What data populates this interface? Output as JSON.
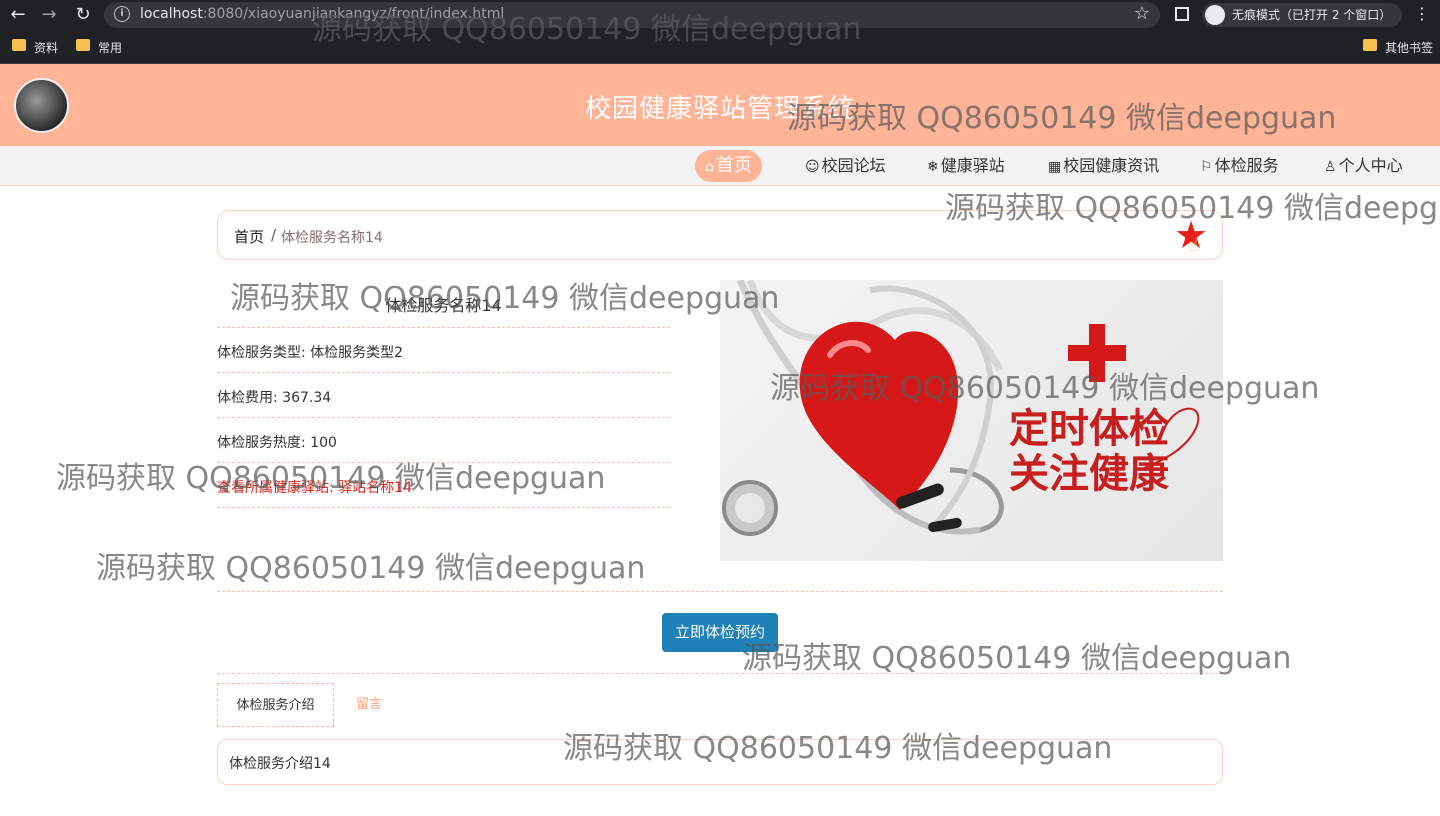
{
  "browser": {
    "url_host": "localhost",
    "url_rest": ":8080/xiaoyuanjiankangyz/front/index.html",
    "incognito_label": "无痕模式（已打开 2 个窗口）",
    "bookmarks": [
      "资料",
      "常用"
    ],
    "other_bookmarks": "其他书签"
  },
  "site": {
    "title": "校园健康驿站管理系统"
  },
  "nav": {
    "items": [
      {
        "icon": "⌂",
        "label": "首页"
      },
      {
        "icon": "☺",
        "label": "校园论坛"
      },
      {
        "icon": "❄",
        "label": "健康驿站"
      },
      {
        "icon": "▦",
        "label": "校园健康资讯"
      },
      {
        "icon": "⚐",
        "label": "体检服务"
      },
      {
        "icon": "♙",
        "label": "个人中心"
      }
    ]
  },
  "breadcrumb": {
    "home": "首页",
    "separator": "/",
    "current": "体检服务名称14"
  },
  "detail": {
    "title": "体检服务名称14",
    "type": "体检服务类型: 体检服务类型2",
    "fee": "体检费用: 367.34",
    "heat": "体检服务热度: 100",
    "station_link": "查看所属健康驿站: 驿站名称14",
    "hero_text_1": "定时体检",
    "hero_text_2": "关注健康"
  },
  "actions": {
    "book_button": "立即体检预约"
  },
  "tabs": {
    "intro": "体检服务介绍",
    "comments": "留言"
  },
  "intro": {
    "text": "体检服务介绍14"
  },
  "watermark": "源码获取 QQ86050149 微信deepguan",
  "colors": {
    "header_bg": "#ffb497",
    "button_bg": "#1f81b8",
    "link_red": "#d9261c"
  }
}
